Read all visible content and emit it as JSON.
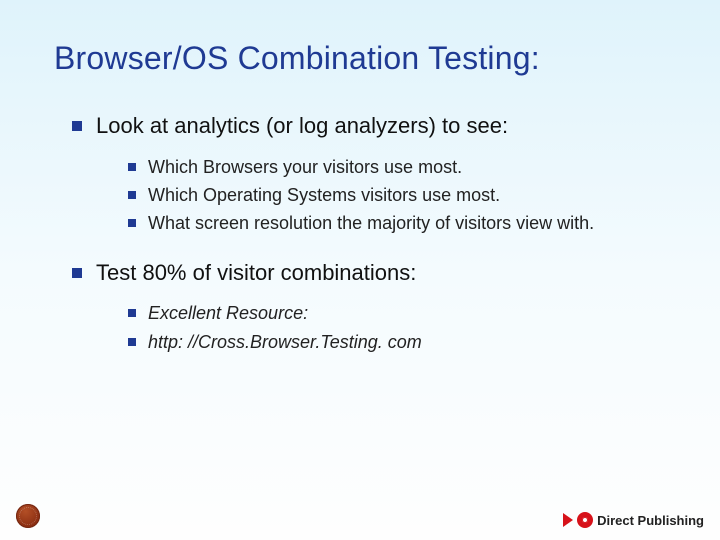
{
  "title": "Browser/OS Combination Testing:",
  "bullets": {
    "b1": {
      "text": "Look at analytics (or log analyzers) to see:",
      "sub": [
        "Which Browsers your visitors use most.",
        "Which Operating Systems visitors use most.",
        "What screen resolution the majority of visitors view with."
      ]
    },
    "b2": {
      "text": "Test 80% of visitor combinations:",
      "sub": [
        "Excellent Resource:",
        "http: //Cross.Browser.Testing. com"
      ]
    }
  },
  "footer": {
    "right_brand": "Direct Publishing"
  }
}
